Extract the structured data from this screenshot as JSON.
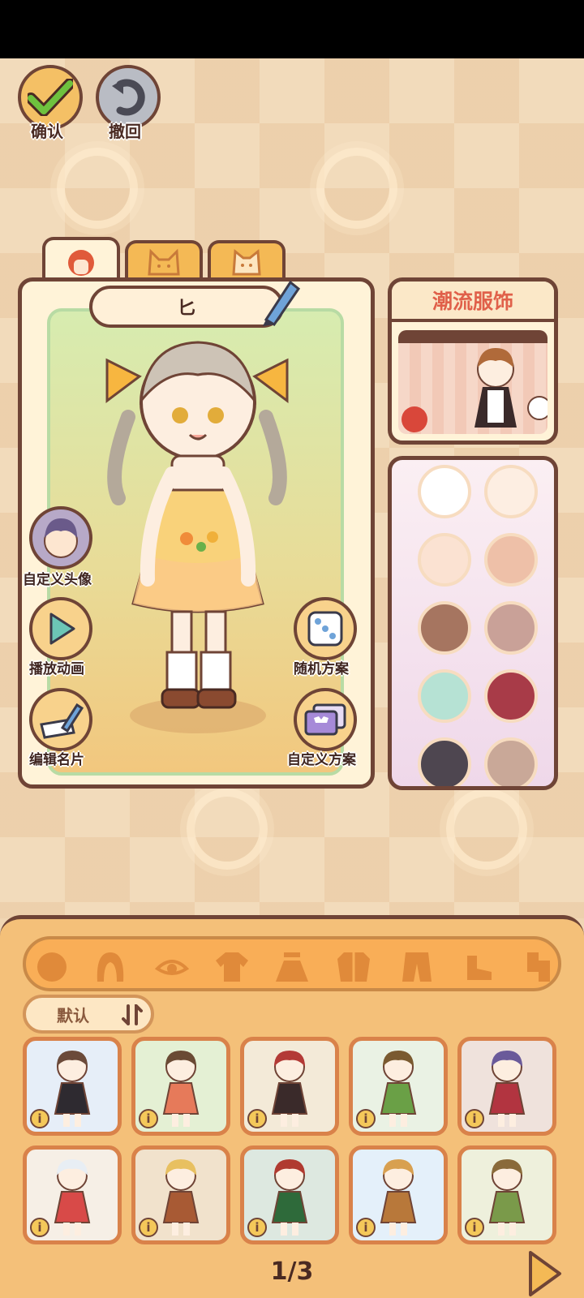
{
  "toolbar": {
    "confirm_label": "确认",
    "undo_label": "撤回"
  },
  "character": {
    "name": "匕",
    "tabs": [
      "person-icon",
      "cat-icon",
      "cat-face-icon"
    ]
  },
  "side_actions": {
    "custom_avatar": "自定义头像",
    "play_animation": "播放动画",
    "edit_card": "编辑名片",
    "random_outfit": "随机方案",
    "custom_outfit": "自定义方案"
  },
  "trend": {
    "title": "潮流服饰"
  },
  "palette": {
    "colors": [
      "#ffffff",
      "#fdeee2",
      "#fbe2d2",
      "#eec0a8",
      "#a67560",
      "#c9a198",
      "#b6e2d4",
      "#a83b48",
      "#4e4650",
      "#c9a898"
    ]
  },
  "categories": [
    "face-icon",
    "hair-icon",
    "eye-icon",
    "top-icon",
    "skirt-icon",
    "coat-icon",
    "pants-icon",
    "shoes-icon",
    "accessory-icon"
  ],
  "sort": {
    "label": "默认"
  },
  "outfits": {
    "cards": [
      {
        "bg": "#e6eef8",
        "hair": "#6b4a3a",
        "cloth": "#2e2a30"
      },
      {
        "bg": "#e4f0d4",
        "hair": "#6a4a34",
        "cloth": "#e67a5a"
      },
      {
        "bg": "#f3ead8",
        "hair": "#b33a36",
        "cloth": "#3a2a2a"
      },
      {
        "bg": "#eaf2e4",
        "hair": "#7a5a30",
        "cloth": "#6aa046"
      },
      {
        "bg": "#efe2dc",
        "hair": "#6a5a9a",
        "cloth": "#b23440"
      },
      {
        "bg": "#f6efe6",
        "hair": "#e8eef4",
        "cloth": "#d84a48"
      },
      {
        "bg": "#f1e2cc",
        "hair": "#e8c060",
        "cloth": "#a85a34"
      },
      {
        "bg": "#dde8e0",
        "hair": "#b03a30",
        "cloth": "#2e6a3a"
      },
      {
        "bg": "#e4f0fa",
        "hair": "#d8a050",
        "cloth": "#b8783a"
      },
      {
        "bg": "#eef0dc",
        "hair": "#8a6a3a",
        "cloth": "#7a9a4a"
      }
    ],
    "info_symbol": "i"
  },
  "pager": {
    "text": "1/3"
  }
}
